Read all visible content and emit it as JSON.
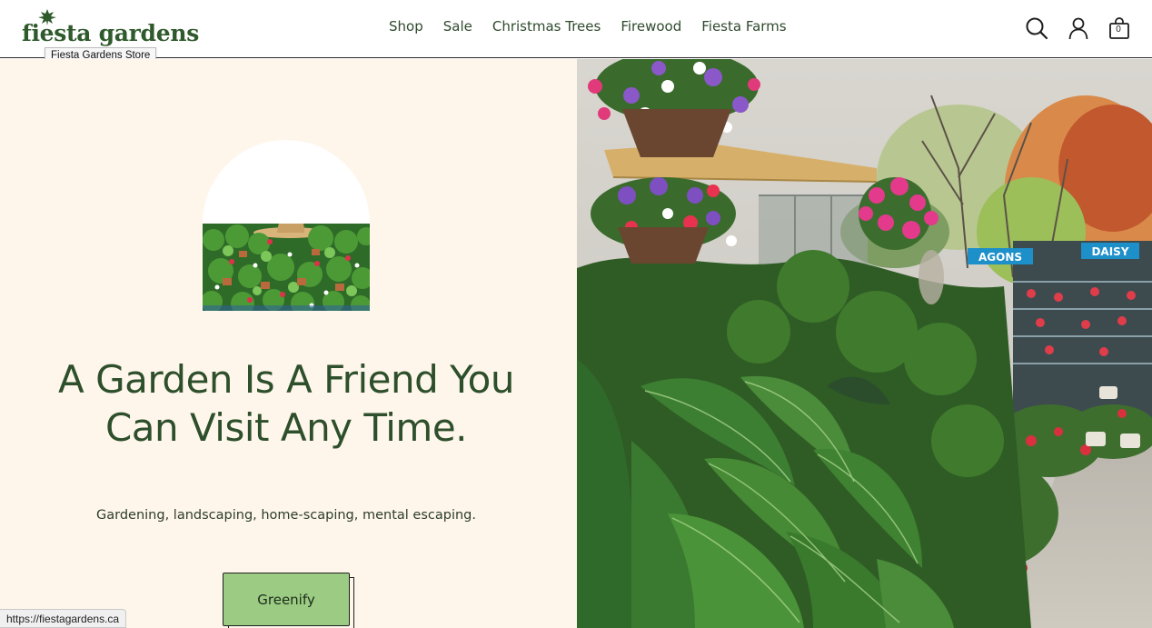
{
  "brand": {
    "logo_text": "fiesta gardens",
    "tooltip": "Fiesta Gardens Store",
    "color": "#2f5a2c"
  },
  "nav": {
    "items": [
      {
        "label": "Shop"
      },
      {
        "label": "Sale"
      },
      {
        "label": "Christmas Trees"
      },
      {
        "label": "Firewood"
      },
      {
        "label": "Fiesta Farms"
      }
    ]
  },
  "header_icons": {
    "search": "search-icon",
    "account": "user-icon",
    "cart": "shopping-bag-icon",
    "cart_count": "0"
  },
  "hero": {
    "headline": "A Garden Is A Friend You Can Visit Any Time.",
    "subline": "Gardening, landscaping, home-scaping, mental escaping.",
    "cta_label": "Greenify",
    "background": "#fff6eb",
    "cta_color": "#9ccc84",
    "photo_signs": [
      "AGONS",
      "DAISY"
    ]
  },
  "status_bar": {
    "url": "https://fiestagardens.ca"
  }
}
